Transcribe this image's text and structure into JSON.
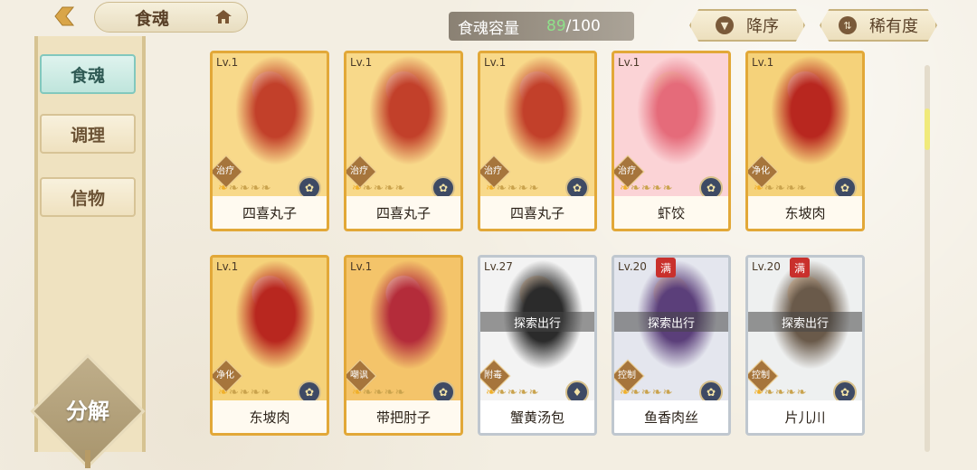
{
  "header": {
    "title": "食魂",
    "capacity_label": "食魂容量",
    "capacity_current": "89",
    "capacity_total": "/100",
    "sort_desc_label": "降序",
    "sort_rarity_label": "稀有度"
  },
  "sidebar": {
    "tabs": [
      {
        "label": "食魂",
        "active": true
      },
      {
        "label": "调理",
        "active": false
      },
      {
        "label": "信物",
        "active": false
      }
    ],
    "decompose_label": "分解"
  },
  "cards": [
    {
      "level": "Lv.1",
      "name": "四喜丸子",
      "role": "治疗",
      "stars_on": 1,
      "element": "✿",
      "art_colors": [
        "#f8d98a",
        "#c2402a"
      ],
      "tier": "gold"
    },
    {
      "level": "Lv.1",
      "name": "四喜丸子",
      "role": "治疗",
      "stars_on": 1,
      "element": "✿",
      "art_colors": [
        "#f8d98a",
        "#c2402a"
      ],
      "tier": "gold"
    },
    {
      "level": "Lv.1",
      "name": "四喜丸子",
      "role": "治疗",
      "stars_on": 1,
      "element": "✿",
      "art_colors": [
        "#f8d98a",
        "#c2402a"
      ],
      "tier": "gold"
    },
    {
      "level": "Lv.1",
      "name": "虾饺",
      "role": "治疗",
      "stars_on": 1,
      "element": "✿",
      "art_colors": [
        "#fbd3d6",
        "#e56b7a"
      ],
      "tier": "gold"
    },
    {
      "level": "Lv.1",
      "name": "东坡肉",
      "role": "净化",
      "stars_on": 1,
      "element": "✿",
      "art_colors": [
        "#f5d27a",
        "#b8271f"
      ],
      "tier": "gold"
    },
    {
      "level": "Lv.1",
      "name": "东坡肉",
      "role": "净化",
      "stars_on": 1,
      "element": "✿",
      "art_colors": [
        "#f5d27a",
        "#b8271f"
      ],
      "tier": "gold"
    },
    {
      "level": "Lv.1",
      "name": "带把肘子",
      "role": "嘲讽",
      "stars_on": 1,
      "element": "✿",
      "art_colors": [
        "#f4c46a",
        "#b42c3a"
      ],
      "tier": "gold"
    },
    {
      "level": "Lv.27",
      "name": "蟹黄汤包",
      "role": "附毒",
      "stars_on": 1,
      "element": "♦",
      "art_colors": [
        "#f3f3f3",
        "#2b2b2b"
      ],
      "tier": "silver",
      "explore": "探索出行"
    },
    {
      "level": "Lv.20",
      "name": "鱼香肉丝",
      "role": "控制",
      "stars_on": 1,
      "element": "✿",
      "art_colors": [
        "#e4e6ee",
        "#5b3f7a"
      ],
      "tier": "silver",
      "explore": "探索出行",
      "max_badge": "满"
    },
    {
      "level": "Lv.20",
      "name": "片儿川",
      "role": "控制",
      "stars_on": 1,
      "element": "✿",
      "art_colors": [
        "#eef0f0",
        "#6a5a4a"
      ],
      "tier": "silver",
      "explore": "探索出行",
      "max_badge": "满"
    }
  ]
}
